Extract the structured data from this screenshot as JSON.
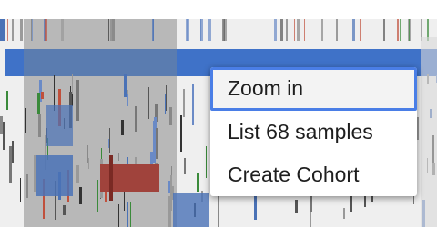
{
  "menu": {
    "items": [
      {
        "name": "zoom-in-item",
        "label": "Zoom in"
      },
      {
        "name": "list-samples-item",
        "label": "List 68 samples"
      },
      {
        "name": "create-cohort-item",
        "label": "Create Cohort"
      }
    ]
  },
  "colors": {
    "background": "#efefef",
    "selection": "#3f72c8",
    "cell_grey": "#b8b8b8",
    "accent": "#4a7ee6",
    "mutation_red": "#a0433c",
    "mutation_blue": "#4a72b6",
    "mutation_green": "#3a8a3a"
  }
}
